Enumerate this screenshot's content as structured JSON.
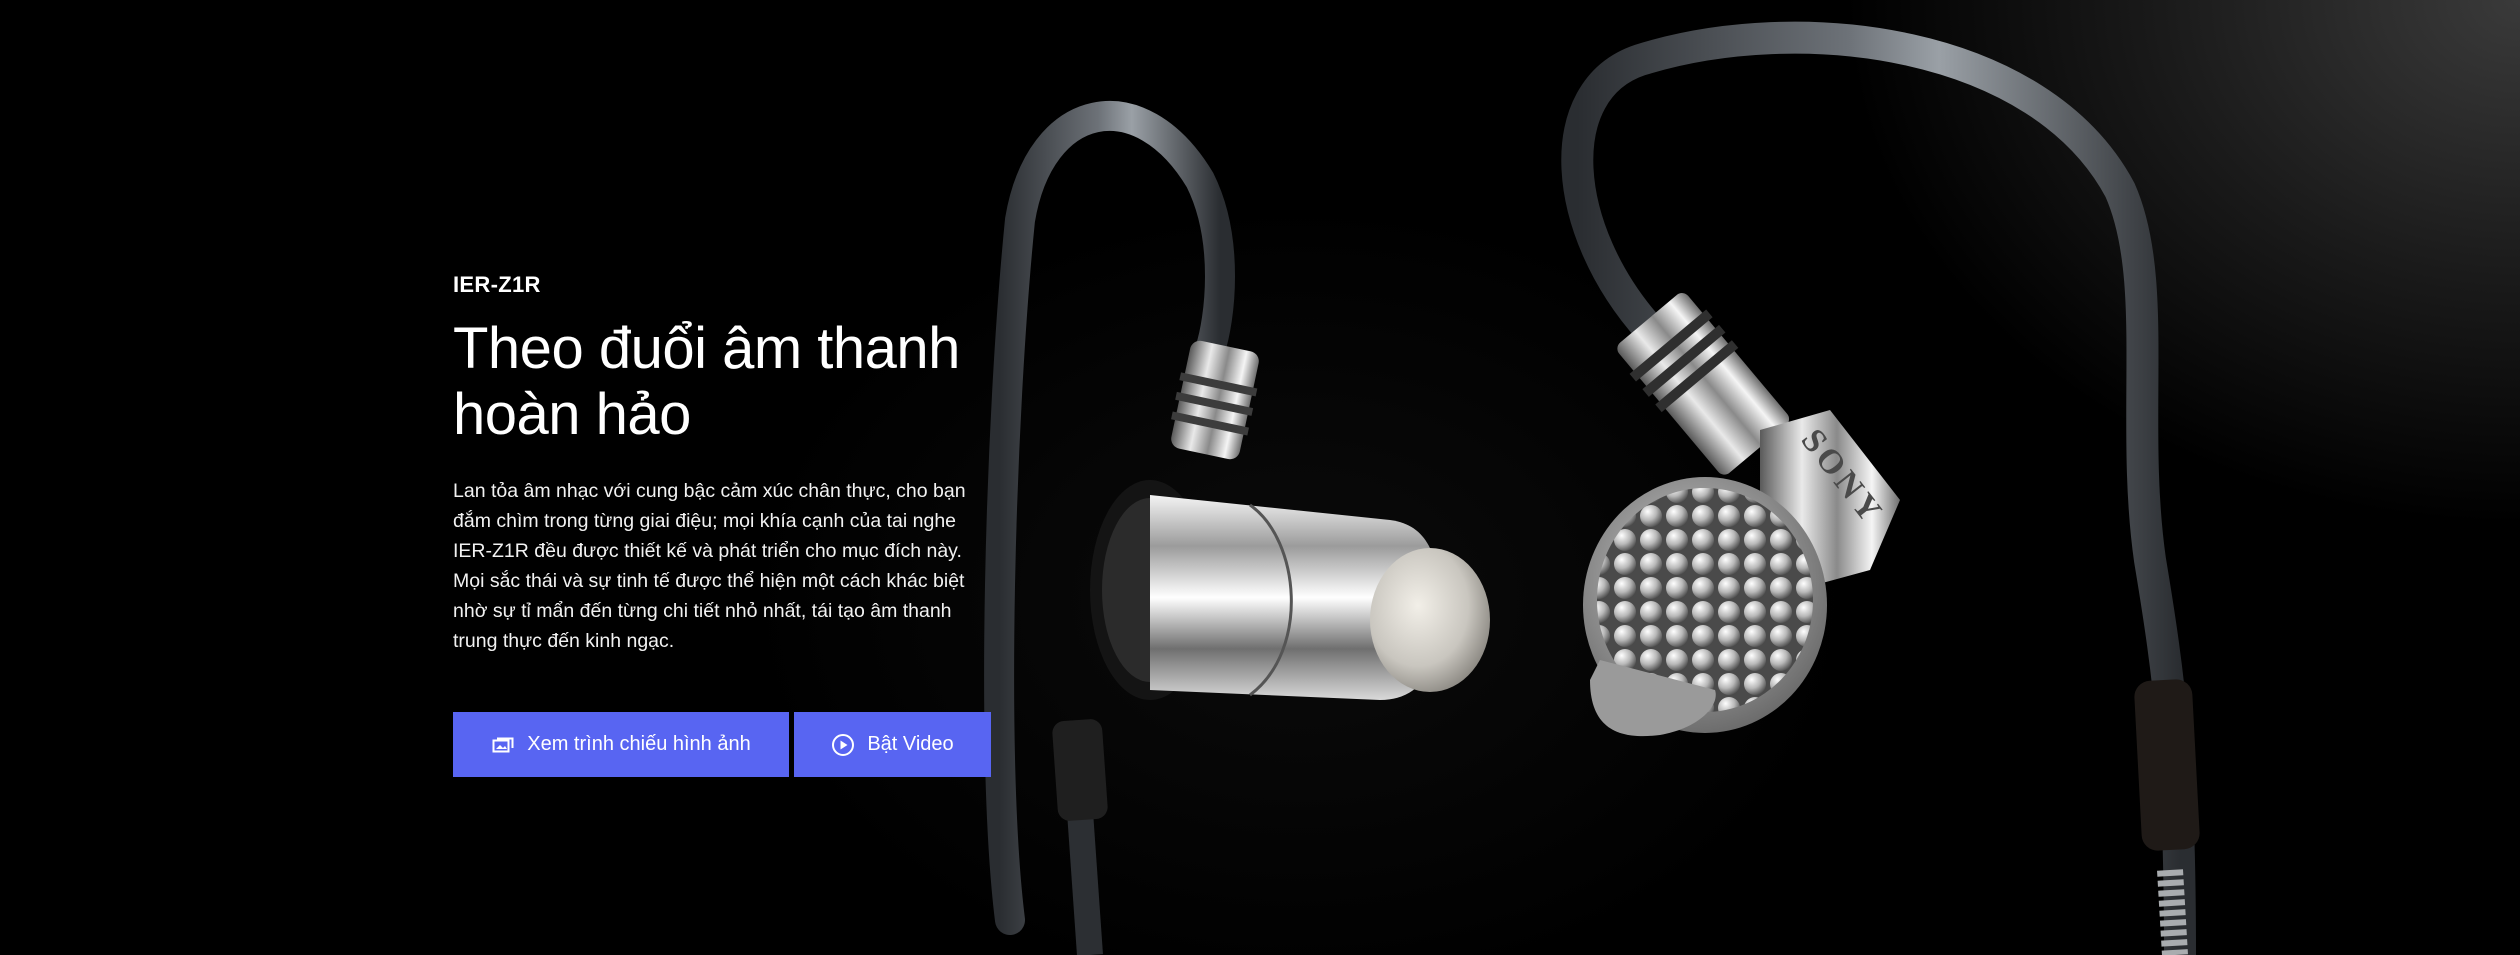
{
  "hero": {
    "model": "IER-Z1R",
    "headline": "Theo đuổi âm thanh hoàn hảo",
    "description": "Lan tỏa âm nhạc với cung bậc cảm xúc chân thực, cho bạn đắm chìm trong từng giai điệu; mọi khía cạnh của tai nghe IER-Z1R đều được thiết kế và phát triển cho mục đích này. Mọi sắc thái và sự tinh tế được thể hiện một cách khác biệt nhờ sự tỉ mẩn đến từng chi tiết nhỏ nhất, tái tạo âm thanh trung thực đến kinh ngạc.",
    "brand_mark": "SONY"
  },
  "actions": {
    "gallery_label": "Xem trình chiếu hình ảnh",
    "gallery_icon": "gallery-icon",
    "video_label": "Bật Video",
    "video_icon": "play-circle-icon"
  },
  "colors": {
    "background": "#000000",
    "button": "#5865f2",
    "text": "#ffffff"
  }
}
